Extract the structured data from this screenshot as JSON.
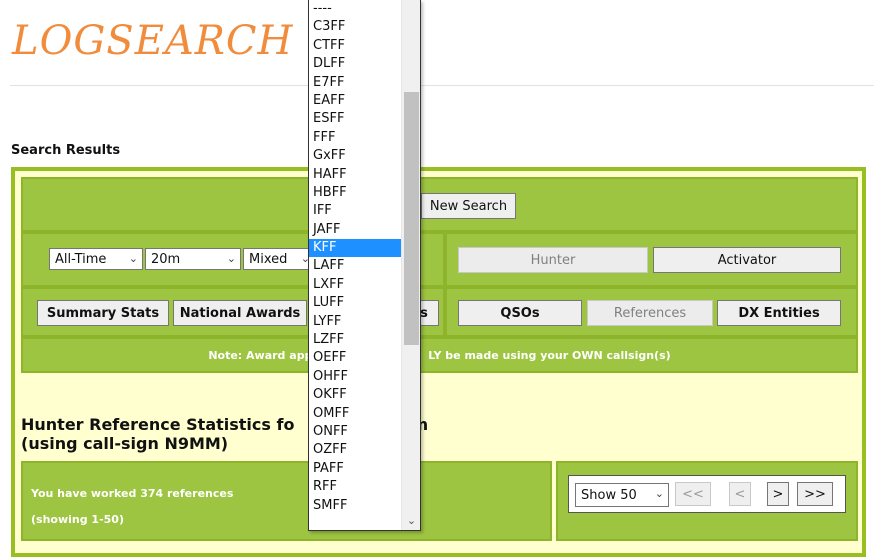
{
  "logo": "LOGSEARCH",
  "heading": "Search Results",
  "buttons": {
    "new_search": "New Search",
    "hunter": "Hunter",
    "activator": "Activator",
    "summary_stats": "Summary Stats",
    "national_awards": "National Awards",
    "third_partial": "s",
    "qsos": "QSOs",
    "references": "References",
    "dx_entities": "DX Entities"
  },
  "filters": {
    "period": "All-Time",
    "band": "20m",
    "mode": "Mixed"
  },
  "note": {
    "left": "Note: Award appl",
    "right": "LY be made using your OWN callsign(s)"
  },
  "stats_title": {
    "line1_left": "Hunter Reference Statistics fo",
    "line1_right": "m",
    "line2": "(using call-sign N9MM)"
  },
  "count": {
    "line1": "You have worked 374 references",
    "line2": "(showing 1-50)"
  },
  "paging": {
    "show": "Show 50",
    "first": "<<",
    "prev": "<",
    "next": ">",
    "last": ">>"
  },
  "dropdown": {
    "items": [
      "----",
      "C3FF",
      "CTFF",
      "DLFF",
      "E7FF",
      "EAFF",
      "ESFF",
      "FFF",
      "GxFF",
      "HAFF",
      "HBFF",
      "IFF",
      "JAFF",
      "KFF",
      "LAFF",
      "LXFF",
      "LUFF",
      "LYFF",
      "LZFF",
      "OEFF",
      "OHFF",
      "OKFF",
      "OMFF",
      "ONFF",
      "OZFF",
      "PAFF",
      "RFF",
      "SMFF"
    ],
    "selected": "KFF"
  },
  "colors": {
    "accent_green": "#9dc541",
    "border_green": "#98bf21",
    "background_yellow": "#ffffd0",
    "logo_orange": "#f08c3c",
    "selection_blue": "#1e90ff"
  }
}
